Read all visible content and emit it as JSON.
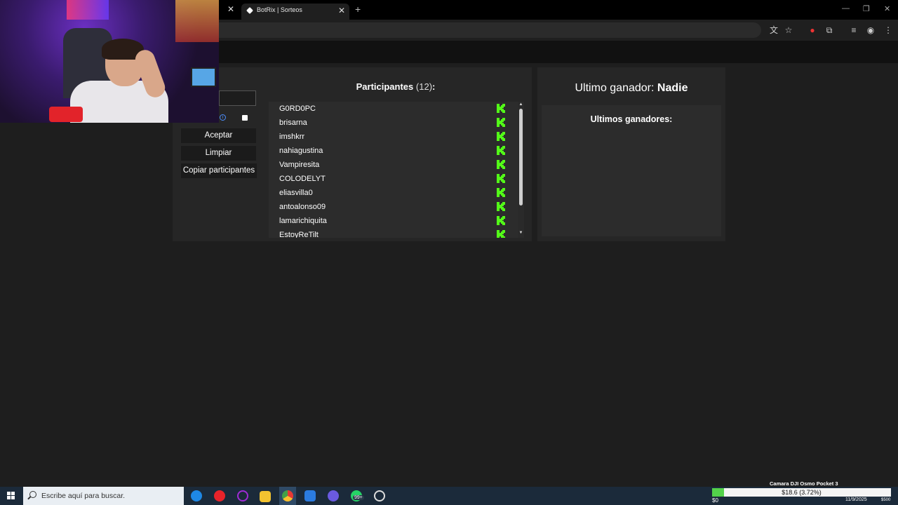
{
  "browser": {
    "tab_title": "BotRix | Sorteos",
    "close_symbol": "✕",
    "new_tab_symbol": "+"
  },
  "app": {
    "buttons": {
      "accept": "Aceptar",
      "clear": "Limpiar",
      "copy": "Copiar participantes"
    },
    "participants": {
      "title": "Participantes",
      "count": "(12)",
      "colon": ":",
      "items": [
        "G0RD0PC",
        "brisarna",
        "imshkrr",
        "nahiagustina",
        "Vampiresita",
        "COLODELYT",
        "eliasvilla0",
        "antoalonso09",
        "lamarichiquita",
        "EstoyReTilt"
      ]
    },
    "winner": {
      "label": "Ultimo ganador:",
      "name": "Nadie"
    },
    "winners_list_title": "Ultimos ganadores:"
  },
  "taskbar": {
    "search_placeholder": "Escribe aquí para buscar.",
    "camera_label": "Camara DJI Osmo Pocket 3",
    "goal_text": "$18.6 (3.72%)",
    "goal_fraction": 0.0372,
    "goal_min": "$0",
    "goal_max": "$500",
    "date": "11/9/2025",
    "badge": "99+"
  },
  "colors": {
    "kick_green": "#53fc18",
    "accent_blue": "#4c8eff"
  }
}
